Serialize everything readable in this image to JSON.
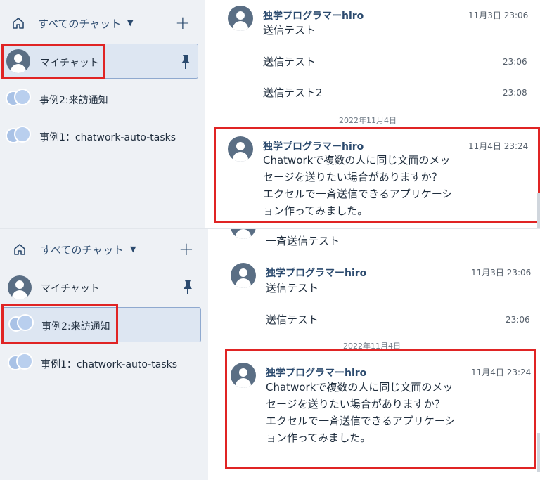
{
  "sidebar": {
    "filter_label": "すべてのチャット",
    "rooms": [
      "マイチャット",
      "事例2:来訪通知",
      "事例1：chatwork-auto-tasks"
    ]
  },
  "messages": {
    "sender": "独学プログラマーhiro",
    "m1_time": "11月3日 23:06",
    "m1_text": "送信テスト",
    "m2_text": "送信テスト",
    "m2_time": "23:06",
    "m3_text": "送信テスト2",
    "m3_time": "23:08",
    "date_separator": "2022年11月4日",
    "m4_time": "11月4日 23:24",
    "m4_line1": "Chatworkで複数の人に同じ文面のメッ",
    "m4_line2": "セージを送りたい場合がありますか？",
    "m4_line3": "エクセルで一斉送信できるアプリケーシ",
    "m4_line4": "ョン作ってみました。",
    "b_partial_text": "一斉送信テスト"
  },
  "colors": {
    "accent": "#2b4a6e",
    "highlight_box": "#e02424",
    "sidebar_bg": "#eef1f5",
    "selected_bg": "#dde6f2"
  }
}
